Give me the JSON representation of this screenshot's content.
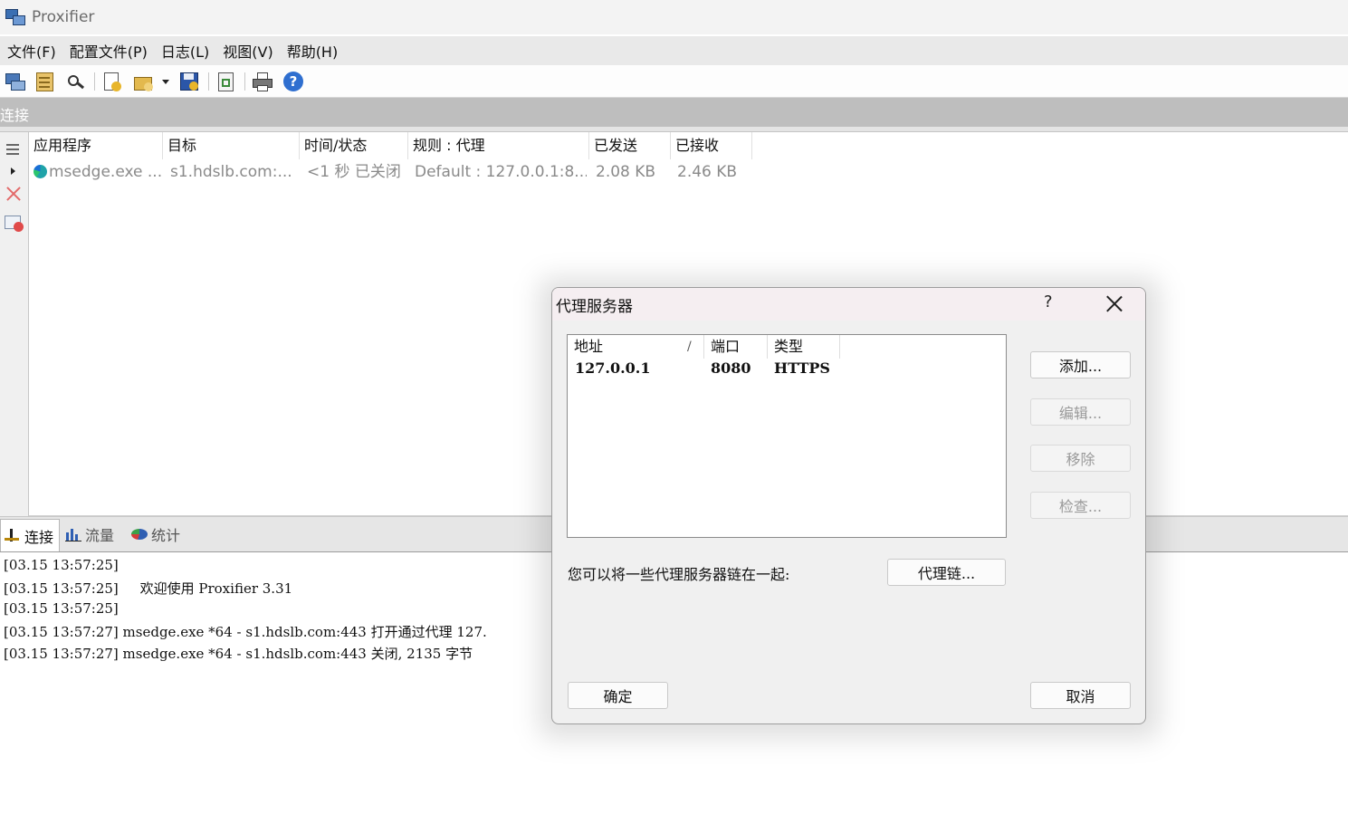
{
  "window": {
    "title": "Proxifier"
  },
  "menu": [
    "文件(F)",
    "配置文件(P)",
    "日志(L)",
    "视图(V)",
    "帮助(H)"
  ],
  "toolbar": {
    "icons": [
      "proxy-servers-icon",
      "proxification-rules-icon",
      "name-resolution-icon",
      "new-profile-icon",
      "open-profile-icon",
      "dropdown-arrow-icon",
      "save-profile-icon",
      "advanced-icon",
      "print-icon",
      "help-icon"
    ]
  },
  "connections": {
    "header": "连接",
    "columns": [
      "应用程序",
      "目标",
      "时间/状态",
      "规则 : 代理",
      "已发送",
      "已接收"
    ],
    "rows": [
      {
        "app": "msedge.exe ...",
        "target": "s1.hdslb.com:...",
        "status": "<1 秒 已关闭",
        "rule": "Default : 127.0.0.1:8...",
        "sent": "2.08 KB",
        "received": "2.46 KB"
      }
    ]
  },
  "bottom_tabs": [
    "连接",
    "流量",
    "统计"
  ],
  "log": [
    "[03.15 13:57:25]",
    "[03.15 13:57:25]     欢迎使用 Proxifier 3.31",
    "[03.15 13:57:25]",
    "[03.15 13:57:27] msedge.exe *64 - s1.hdslb.com:443 打开通过代理 127.",
    "[03.15 13:57:27] msedge.exe *64 - s1.hdslb.com:443 关闭, 2135 字节"
  ],
  "dialog": {
    "title": "代理服务器",
    "help": "?",
    "columns": [
      "地址",
      "端口",
      "类型"
    ],
    "sort_mark": "/",
    "rows": [
      {
        "address": "127.0.0.1",
        "port": "8080",
        "type": "HTTPS"
      }
    ],
    "buttons": {
      "add": "添加...",
      "edit": "编辑...",
      "remove": "移除",
      "check": "检查...",
      "chain": "代理链...",
      "ok": "确定",
      "cancel": "取消"
    },
    "chain_text": "您可以将一些代理服务器链在一起:"
  }
}
